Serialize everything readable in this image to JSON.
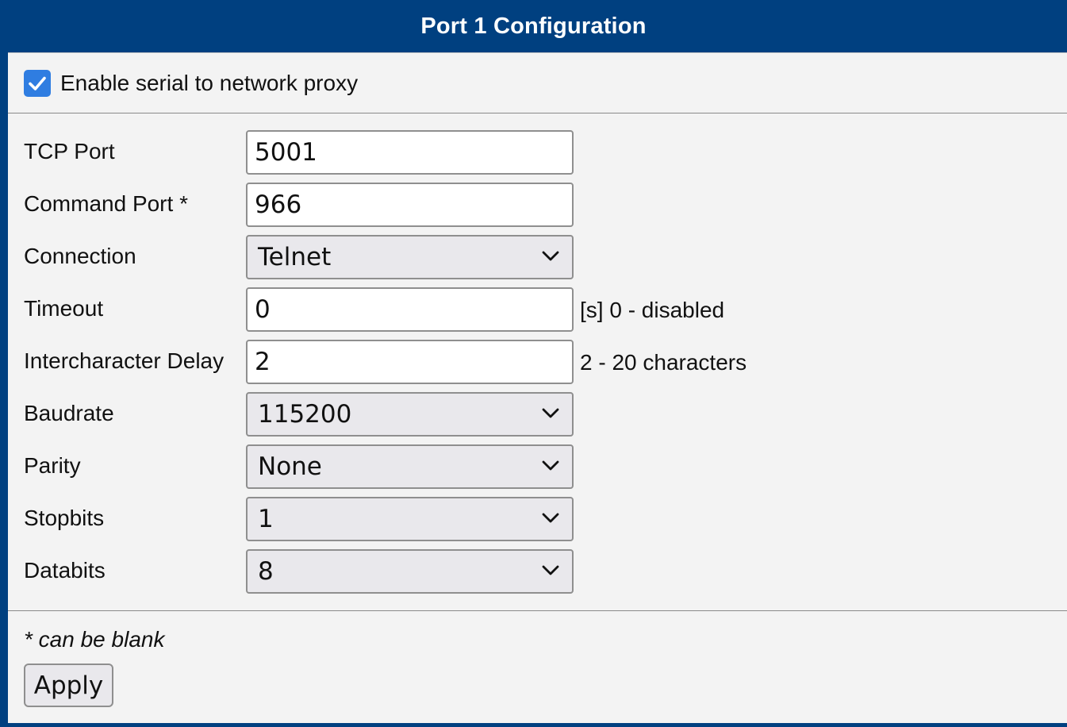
{
  "panel": {
    "title": "Port 1 Configuration"
  },
  "enable_proxy": {
    "label": "Enable serial to network proxy",
    "checked": true,
    "accent_color": "#2f7de1"
  },
  "form": {
    "tcp_port": {
      "label": "TCP Port",
      "value": "5001"
    },
    "command_port": {
      "label": "Command Port *",
      "value": "966"
    },
    "connection": {
      "label": "Connection",
      "selected": "Telnet"
    },
    "timeout": {
      "label": "Timeout",
      "value": "0",
      "hint": "[s] 0 - disabled"
    },
    "intercharacter_delay": {
      "label": "Intercharacter Delay",
      "value": "2",
      "hint": "2 - 20 characters"
    },
    "baudrate": {
      "label": "Baudrate",
      "selected": "115200"
    },
    "parity": {
      "label": "Parity",
      "selected": "None"
    },
    "stopbits": {
      "label": "Stopbits",
      "selected": "1"
    },
    "databits": {
      "label": "Databits",
      "selected": "8"
    }
  },
  "footer": {
    "note": "* can be blank",
    "apply_label": "Apply"
  },
  "colors": {
    "header_bg": "#004080",
    "body_bg": "#f3f3f3",
    "select_bg": "#e9e8ec"
  },
  "icons": {
    "checkbox": "check-icon",
    "select_arrow": "chevron-down-icon"
  }
}
